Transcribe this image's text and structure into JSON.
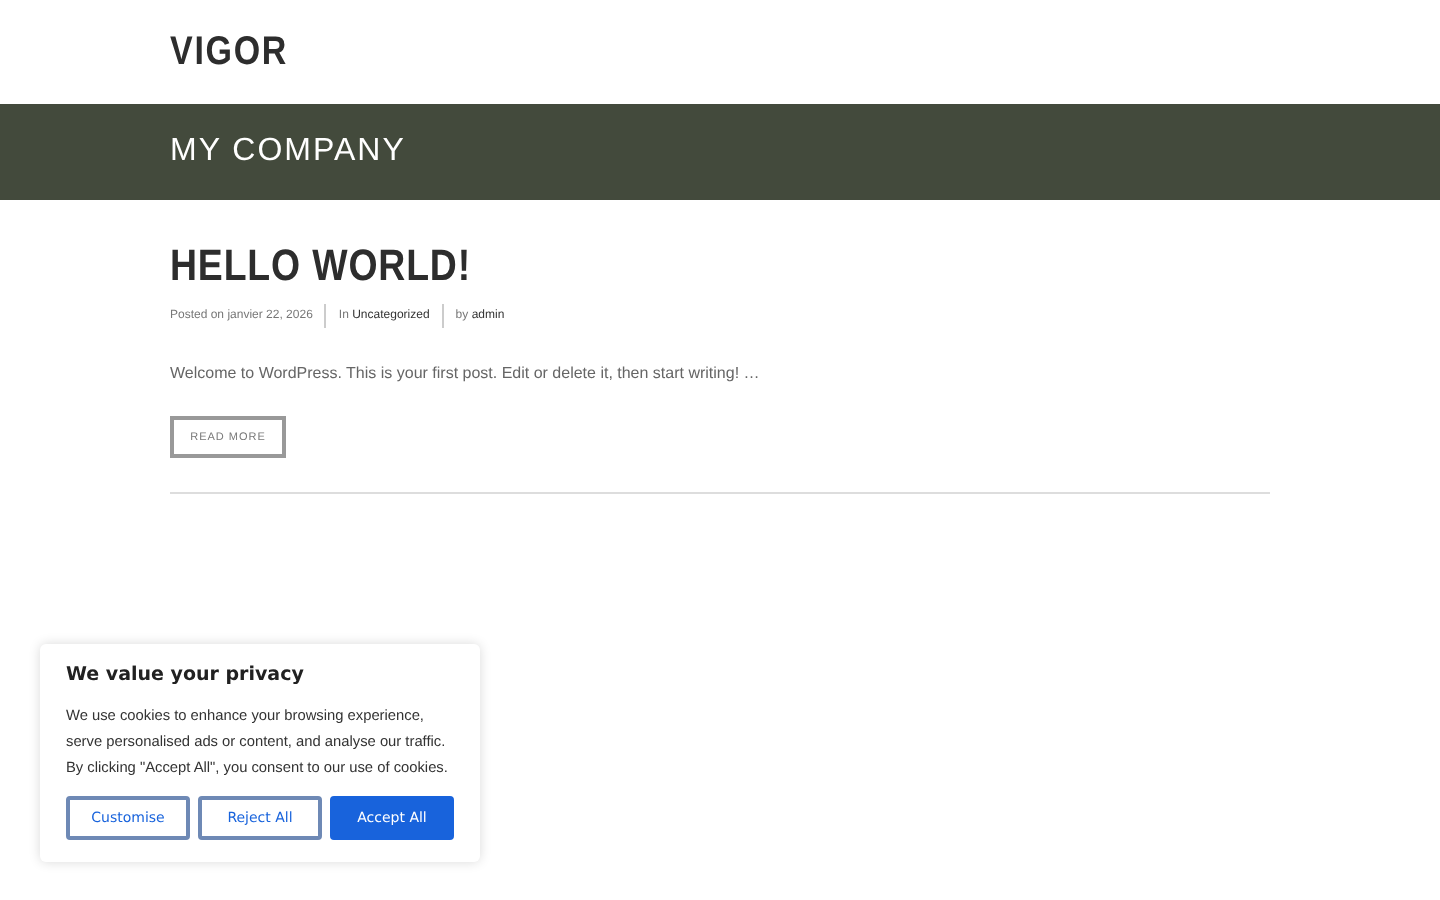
{
  "header": {
    "logo": "VIGOR"
  },
  "banner": {
    "title": "MY COMPANY"
  },
  "post": {
    "title": "HELLO WORLD!",
    "meta": [
      {
        "prefix": "Posted on",
        "value": "janvier 22, 2026",
        "link": false
      },
      {
        "prefix": "In",
        "value": "Uncategorized",
        "link": true
      },
      {
        "prefix": "by",
        "value": "admin",
        "link": true
      }
    ],
    "excerpt": "Welcome to WordPress. This is your first post. Edit or delete it, then start writing! …",
    "button": "READ MORE"
  },
  "cookie_notice": {
    "title": "We value your privacy",
    "text": "We use cookies to enhance your browsing experience, serve personalised ads or content, and analyse our traffic. By clicking \"Accept All\", you consent to our use of cookies.",
    "buttons": [
      {
        "label": "Customise",
        "kind": "outline"
      },
      {
        "label": "Reject All",
        "kind": "outline"
      },
      {
        "label": "Accept All",
        "kind": "primary"
      }
    ]
  }
}
